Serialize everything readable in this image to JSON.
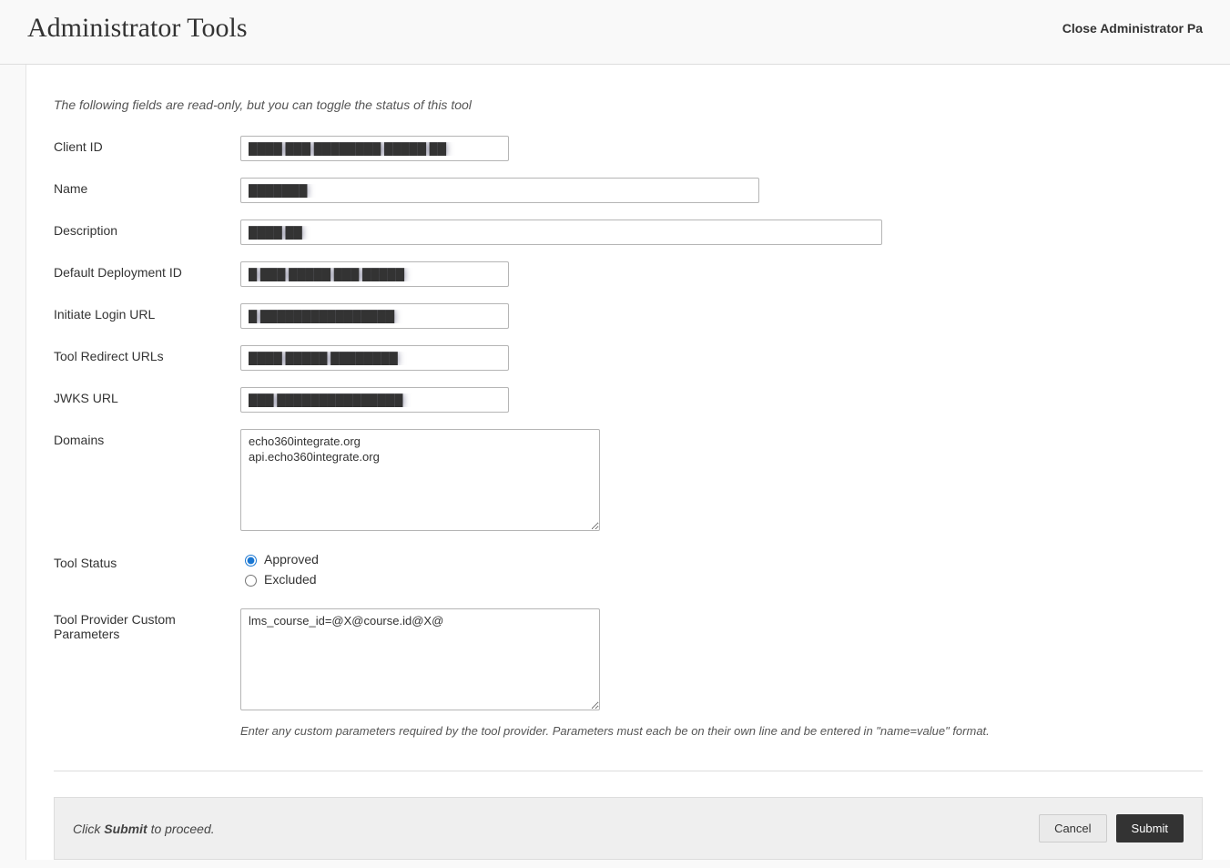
{
  "header": {
    "title": "Administrator Tools",
    "close": "Close Administrator Pa"
  },
  "intro": "The following fields are read-only, but you can toggle the status of this tool",
  "labels": {
    "client_id": "Client ID",
    "name": "Name",
    "description": "Description",
    "deployment_id": "Default Deployment ID",
    "initiate_login_url": "Initiate Login URL",
    "redirect_urls": "Tool Redirect URLs",
    "jwks_url": "JWKS URL",
    "domains": "Domains",
    "tool_status": "Tool Status",
    "custom_params": "Tool Provider Custom Parameters"
  },
  "values": {
    "client_id": "████ ███ ████████ █████ ██",
    "name": "███████",
    "description": "████ ██",
    "deployment_id": "█ ███ █████ ███ █████",
    "initiate_login_url": "█ ████████████████",
    "redirect_urls": "████ █████ ████████",
    "jwks_url": "███ ███████████████",
    "domains": "echo360integrate.org\napi.echo360integrate.org",
    "custom_params": "lms_course_id=@X@course.id@X@"
  },
  "status": {
    "approved": "Approved",
    "excluded": "Excluded",
    "selected": "approved"
  },
  "help": {
    "custom_params": "Enter any custom parameters required by the tool provider. Parameters must each be on their own line and be entered in \"name=value\" format."
  },
  "footer": {
    "note_prefix": "Click ",
    "note_bold": "Submit",
    "note_suffix": " to proceed.",
    "cancel": "Cancel",
    "submit": "Submit"
  }
}
